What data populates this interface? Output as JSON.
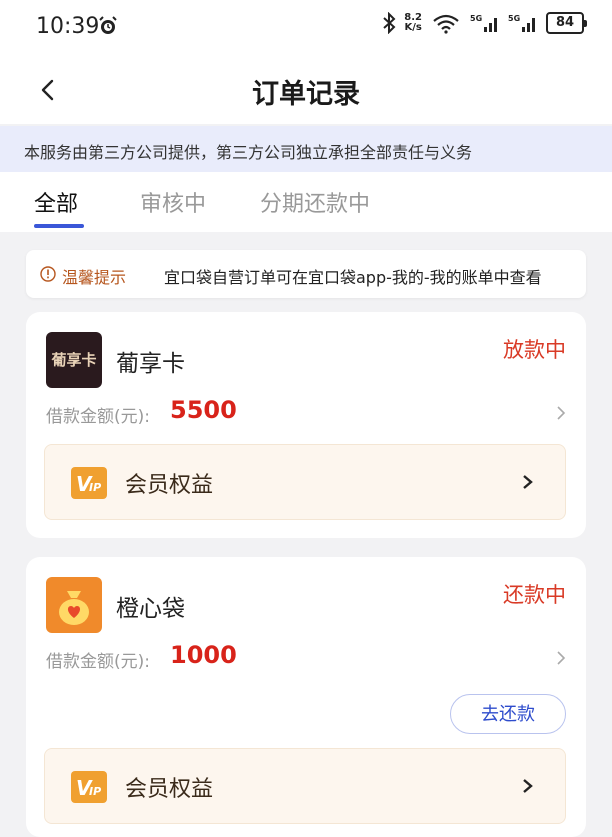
{
  "status_bar": {
    "time": "10:39",
    "net_speed_top": "8.2",
    "net_speed_bottom": "K/s",
    "battery": "84"
  },
  "header": {
    "title": "订单记录",
    "back_icon": "chevron-left-icon"
  },
  "notice": {
    "text": "本服务由第三方公司提供，第三方公司独立承担全部责任与义务"
  },
  "tabs": [
    {
      "label": "全部",
      "active": true
    },
    {
      "label": "审核中",
      "active": false
    },
    {
      "label": "分期还款中",
      "active": false
    }
  ],
  "tip": {
    "label": "温馨提示",
    "text": "宜口袋自营订单可在宜口袋app-我的-我的账单中查看"
  },
  "orders": [
    {
      "product": "葡享卡",
      "logo_text": "葡享卡",
      "status": "放款中",
      "amount_label": "借款金额(元):",
      "amount": "5500",
      "vip_label": "会员权益"
    },
    {
      "product": "橙心袋",
      "status": "还款中",
      "amount_label": "借款金额(元):",
      "amount": "1000",
      "action_label": "去还款",
      "vip_label": "会员权益"
    }
  ],
  "colors": {
    "accent": "#3a57d8",
    "status_red": "#d93a26",
    "amount_red": "#d8231a",
    "notice_bg": "#e9ecfb",
    "vip_bg": "#fdf6ee"
  }
}
